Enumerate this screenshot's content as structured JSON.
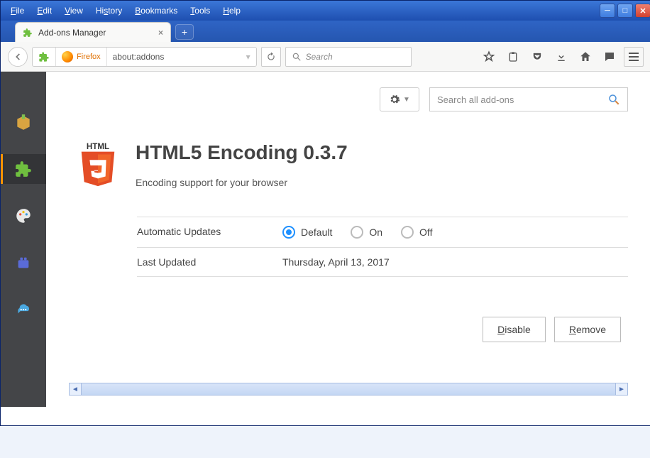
{
  "window": {
    "controls": {
      "min": "_",
      "max": "▢",
      "close": "×"
    }
  },
  "menubar": [
    "File",
    "Edit",
    "View",
    "History",
    "Bookmarks",
    "Tools",
    "Help"
  ],
  "tab": {
    "title": "Add-ons Manager"
  },
  "identity": {
    "brand": "Firefox",
    "address": "about:addons"
  },
  "toolbar": {
    "search_placeholder": "Search"
  },
  "sidebar": {
    "items": [
      "get-addons",
      "extensions",
      "appearance",
      "plugins",
      "services"
    ],
    "active_index": 1
  },
  "addons_page": {
    "search_placeholder": "Search all add-ons",
    "addon": {
      "name": "HTML5 Encoding",
      "version": "0.3.7",
      "title": "HTML5 Encoding 0.3.7",
      "description": "Encoding support for your browser",
      "updates_label": "Automatic Updates",
      "updates_options": [
        "Default",
        "On",
        "Off"
      ],
      "updates_selected": "Default",
      "last_updated_label": "Last Updated",
      "last_updated_value": "Thursday, April 13, 2017",
      "disable_label": "Disable",
      "remove_label": "Remove"
    }
  }
}
